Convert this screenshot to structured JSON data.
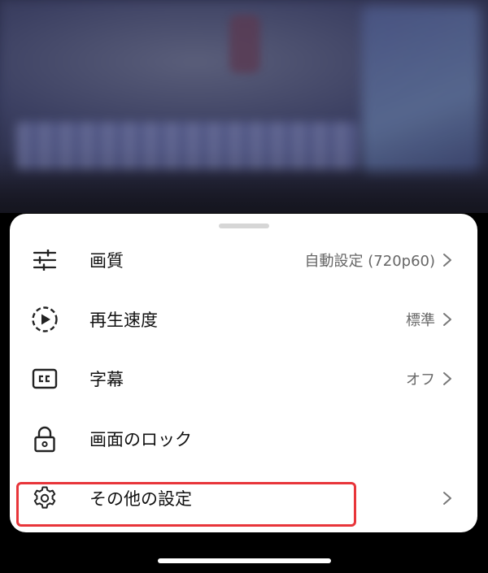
{
  "menu": {
    "items": [
      {
        "label": "画質",
        "value": "自動設定 (720p60)",
        "icon": "sliders-icon",
        "has_chevron": true
      },
      {
        "label": "再生速度",
        "value": "標準",
        "icon": "playback-speed-icon",
        "has_chevron": true
      },
      {
        "label": "字幕",
        "value": "オフ",
        "icon": "cc-icon",
        "has_chevron": true
      },
      {
        "label": "画面のロック",
        "value": "",
        "icon": "lock-icon",
        "has_chevron": false
      },
      {
        "label": "その他の設定",
        "value": "",
        "icon": "gear-icon",
        "has_chevron": true
      }
    ]
  },
  "colors": {
    "highlight": "#e8353a",
    "sheet_bg": "#ffffff",
    "text": "#111111",
    "secondary_text": "#666666"
  }
}
